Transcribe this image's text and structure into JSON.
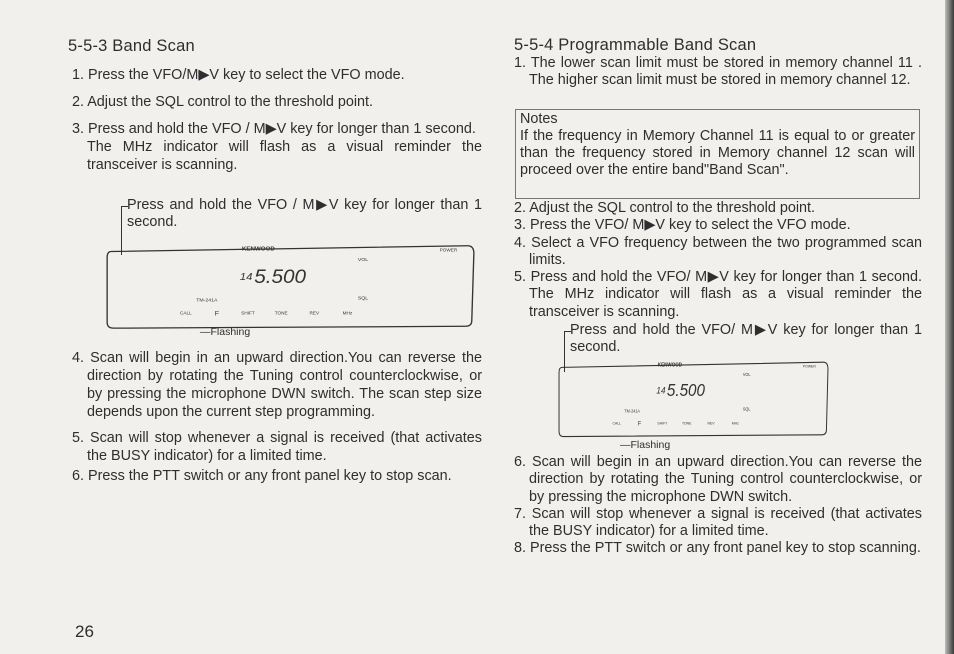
{
  "left": {
    "heading": "5-5-3    Band Scan",
    "steps": [
      "1. Press the VFO/M▶V key to select the VFO mode.",
      "2. Adjust the SQL control to the threshold point.",
      "3. Press and hold the VFO / M▶V key for longer than 1 second.",
      "The MHz indicator will flash as a visual reminder  the transceiver is scanning.",
      "4. Scan will begin in an upward direction.You can reverse the direction by rotating the Tuning control counterclockwise, or by pressing the microphone DWN switch. The scan step size depends upon the current step programming.",
      "5. Scan will stop whenever a signal is received (that activates the BUSY indicator) for a limited time.",
      "6. Press the PTT switch or any front panel key to stop scan."
    ],
    "callout": "Press and hold the VFO / M▶V key for longer than 1 second.",
    "flashing": "Flashing"
  },
  "right": {
    "heading": "5-5-4    Programmable Band Scan",
    "step1": "1. The lower scan limit must be stored in memory channel 11 . The higher scan limit must be stored in memory channel 12.",
    "notes_title": "Notes",
    "notes_body": "If the frequency in Memory Channel 11 is equal to or greater than the frequency stored in Memory channel 12 scan will proceed over the entire band\"Band Scan\".",
    "steps": [
      "2. Adjust the SQL control to the threshold point.",
      "3. Press the VFO/ M▶V key to select the VFO mode.",
      "4. Select a VFO frequency between the two programmed scan limits.",
      "5. Press and hold the VFO/ M▶V key for longer than 1 second. The MHz indicator will flash as a visual reminder  the transceiver is scanning.",
      "6. Scan will begin in an upward direction.You can reverse the direction by rotating the Tuning control counterclockwise, or by pressing the microphone DWN switch.",
      "7. Scan will stop whenever a signal is received (that activates the BUSY indicator) for a limited time.",
      "8. Press the PTT switch or any front panel key to stop scanning."
    ],
    "callout": "Press and hold the VFO/ M▶V key for longer than 1 second.",
    "flashing": "Flashing"
  },
  "radio": {
    "brand": "KENWOOD",
    "freq_small": "14",
    "freq_large": "5.500",
    "model": "TM-241A",
    "vol": "VOL",
    "sql": "SQL",
    "power": "POWER",
    "buttons": [
      "CALL",
      "F",
      "SHIFT",
      "TONE",
      "REV",
      "MHz"
    ]
  },
  "page_number": "26"
}
